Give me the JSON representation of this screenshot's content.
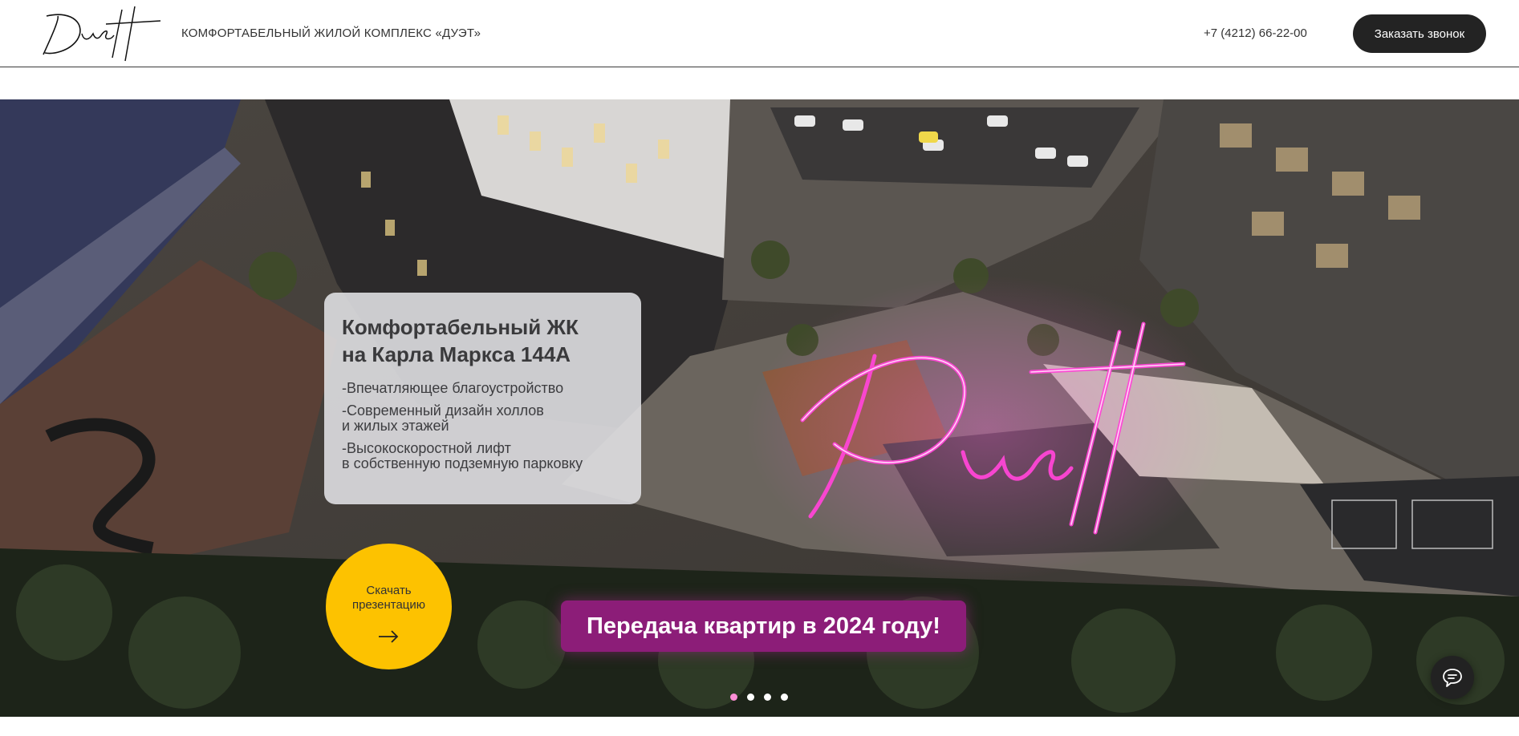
{
  "header": {
    "logo_text": "Duett",
    "tagline": "КОМФОРТАБЕЛЬНЫЙ ЖИЛОЙ КОМПЛЕКС «ДУЭТ»",
    "phone": "+7 (4212) 66-22-00",
    "call_button": "Заказать звонок"
  },
  "hero": {
    "neon_sign": "Duett",
    "card": {
      "title_line1": "Комфортабельный ЖК",
      "title_line2": "на Карла Маркса 144А",
      "features": [
        "-Впечатляющее благоустройство",
        "-Современный дизайн холлов\nи жилых этажей",
        "-Высокоскоростной лифт\nв собственную подземную парковку"
      ]
    },
    "download_button": "Скачать\nпрезентацию",
    "promo": "Передача квартир в 2024 году!",
    "slides_count": 4,
    "active_slide": 1
  },
  "icons": {
    "download_arrow": "arrow-right-icon",
    "chat": "chat-bubble-icon"
  },
  "colors": {
    "accent_yellow": "#fdc200",
    "promo_purple": "#8c1d78",
    "neon_pink": "#ff3fd0",
    "button_dark": "#232323"
  }
}
